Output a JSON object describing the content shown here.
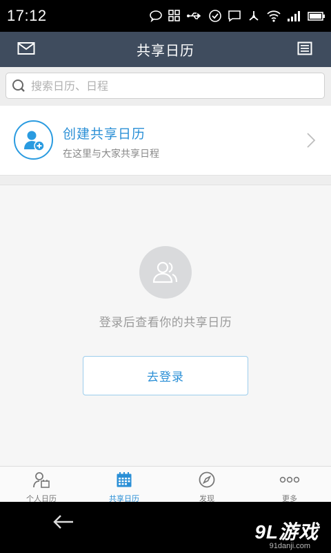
{
  "status_bar": {
    "time": "17:12",
    "icons": [
      "chat-bubble-icon",
      "grid-icon",
      "usb-icon",
      "check-circle-icon",
      "message-icon",
      "share-node-icon",
      "wifi-icon",
      "signal-icon",
      "battery-icon"
    ]
  },
  "header": {
    "title": "共享日历",
    "left_icon": "mail-icon",
    "right_icon": "list-icon"
  },
  "search": {
    "placeholder": "搜索日历、日程"
  },
  "create": {
    "title": "创建共享日历",
    "subtitle": "在这里与大家共享日程"
  },
  "empty_state": {
    "message": "登录后查看你的共享日历",
    "login_label": "去登录"
  },
  "tabs": [
    {
      "label": "个人日历",
      "icon": "person-calendar-icon",
      "active": false
    },
    {
      "label": "共享日历",
      "icon": "calendar-icon",
      "active": true
    },
    {
      "label": "发现",
      "icon": "compass-icon",
      "active": false
    },
    {
      "label": "更多",
      "icon": "more-dots-icon",
      "active": false
    }
  ],
  "watermark": {
    "logo": "9L游戏",
    "url": "91danji.com"
  },
  "colors": {
    "header_bg": "#3f4c5e",
    "accent": "#2a8fd6",
    "status_bar": "#000000"
  }
}
